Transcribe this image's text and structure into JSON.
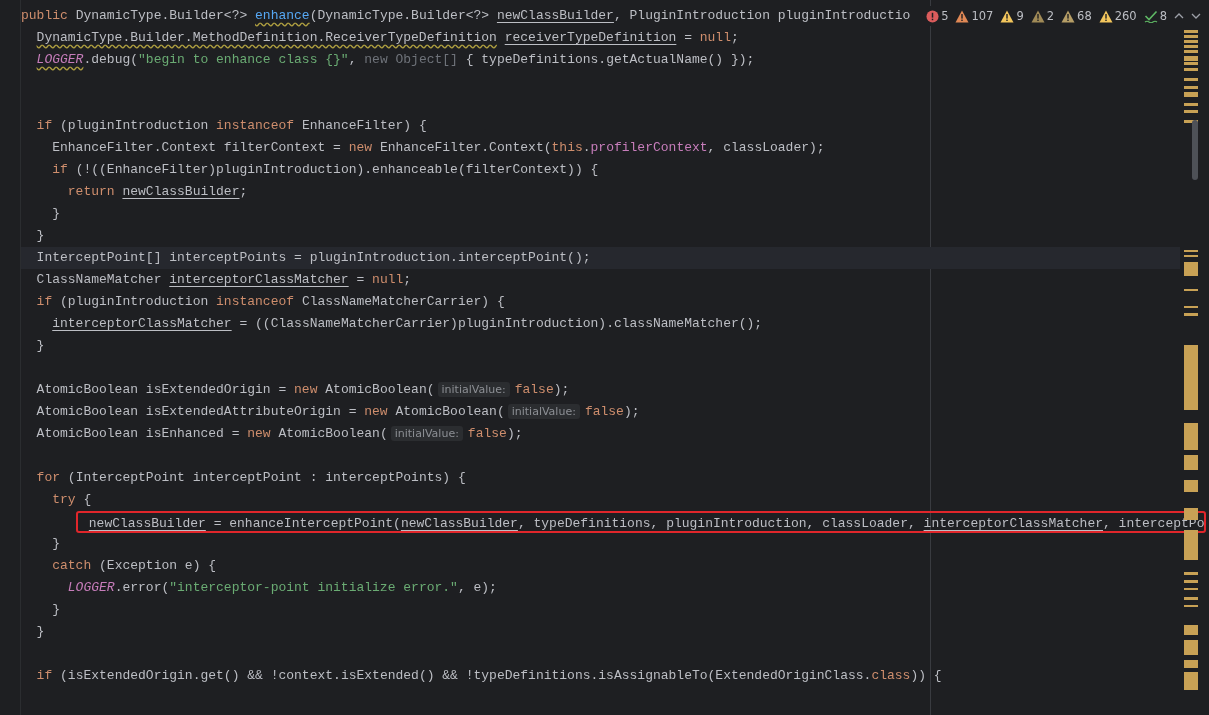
{
  "inspection": {
    "items": [
      {
        "kind": "error",
        "count": "5",
        "color": "#db5c5c"
      },
      {
        "kind": "warning",
        "count": "107",
        "color": "#e08855"
      },
      {
        "kind": "warning",
        "count": "9",
        "color": "#f2c55c"
      },
      {
        "kind": "warning",
        "count": "2",
        "color": "#a08a57"
      },
      {
        "kind": "warning",
        "count": "68",
        "color": "#b59d66"
      },
      {
        "kind": "warning",
        "count": "260",
        "color": "#f2c55c"
      },
      {
        "kind": "check",
        "count": "8",
        "color": "#5fb865"
      }
    ]
  },
  "blocks": [
    {
      "lines": [
        {
          "current": false,
          "highlighted": false,
          "tokens": [
            {
              "kind": "keyword",
              "text": "public"
            },
            {
              "kind": "plain",
              "text": " DynamicType.Builder<?> "
            },
            {
              "kind": "warnedmethod",
              "text": "enhance"
            },
            {
              "kind": "plain",
              "text": "(DynamicType.Builder<?> "
            },
            {
              "kind": "reassigned",
              "text": "newClassBuilder"
            },
            {
              "kind": "plain",
              "text": ", PluginIntroduction pluginIntroductio"
            }
          ]
        },
        {
          "current": false,
          "highlighted": false,
          "tokens": [
            {
              "kind": "warned",
              "text": "  DynamicType.Builder.MethodDefinition.ReceiverTypeDefinition"
            },
            {
              "kind": "reassigned",
              "text": " receiverTypeDefinition"
            },
            {
              "kind": "plain",
              "text": " = "
            },
            {
              "kind": "keyword",
              "text": "null"
            },
            {
              "kind": "plain",
              "text": ";"
            }
          ]
        },
        {
          "current": false,
          "highlighted": false,
          "tokens": [
            {
              "kind": "warnedstatic",
              "text": "  LOGGER"
            },
            {
              "kind": "plain",
              "text": ".debug("
            },
            {
              "kind": "string",
              "text": "\"begin to enhance class {}\""
            },
            {
              "kind": "plain",
              "text": ", "
            },
            {
              "kind": "dim",
              "text": "new Object[]"
            },
            {
              "kind": "plain",
              "text": " { typeDefinitions.getActualName() });"
            }
          ]
        }
      ]
    },
    {
      "lines": [
        {
          "current": false,
          "highlighted": false,
          "tokens": [
            {
              "kind": "keyword",
              "text": "  if"
            },
            {
              "kind": "plain",
              "text": " (pluginIntroduction "
            },
            {
              "kind": "keyword",
              "text": "instanceof"
            },
            {
              "kind": "plain",
              "text": " EnhanceFilter) {"
            }
          ]
        },
        {
          "current": false,
          "highlighted": false,
          "tokens": [
            {
              "kind": "plain",
              "text": "    EnhanceFilter.Context filterContext = "
            },
            {
              "kind": "keyword",
              "text": "new"
            },
            {
              "kind": "plain",
              "text": " EnhanceFilter.Context("
            },
            {
              "kind": "keyword",
              "text": "this"
            },
            {
              "kind": "plain",
              "text": "."
            },
            {
              "kind": "field",
              "text": "profilerContext"
            },
            {
              "kind": "plain",
              "text": ", classLoader);"
            }
          ]
        },
        {
          "current": false,
          "highlighted": false,
          "tokens": [
            {
              "kind": "keyword",
              "text": "    if"
            },
            {
              "kind": "plain",
              "text": " (!((EnhanceFilter)pluginIntroduction).enhanceable(filterContext)) {"
            }
          ]
        },
        {
          "current": false,
          "highlighted": false,
          "tokens": [
            {
              "kind": "keyword",
              "text": "      return"
            },
            {
              "kind": "reassigned",
              "text": " newClassBuilder"
            },
            {
              "kind": "plain",
              "text": ";"
            }
          ]
        },
        {
          "current": false,
          "highlighted": false,
          "tokens": [
            {
              "kind": "plain",
              "text": "    }"
            }
          ]
        },
        {
          "current": false,
          "highlighted": false,
          "tokens": [
            {
              "kind": "plain",
              "text": "  }"
            }
          ]
        },
        {
          "current": true,
          "highlighted": false,
          "tokens": [
            {
              "kind": "plain",
              "text": "  InterceptPoint[] interceptPoints = pluginIntroduction.interceptPoint();"
            }
          ]
        },
        {
          "current": false,
          "highlighted": false,
          "tokens": [
            {
              "kind": "plain",
              "text": "  ClassNameMatcher "
            },
            {
              "kind": "reassigned",
              "text": "interceptorClassMatcher"
            },
            {
              "kind": "plain",
              "text": " = "
            },
            {
              "kind": "keyword",
              "text": "null"
            },
            {
              "kind": "plain",
              "text": ";"
            }
          ]
        },
        {
          "current": false,
          "highlighted": false,
          "tokens": [
            {
              "kind": "keyword",
              "text": "  if"
            },
            {
              "kind": "plain",
              "text": " (pluginIntroduction "
            },
            {
              "kind": "keyword",
              "text": "instanceof"
            },
            {
              "kind": "plain",
              "text": " ClassNameMatcherCarrier) {"
            }
          ]
        },
        {
          "current": false,
          "highlighted": false,
          "tokens": [
            {
              "kind": "reassigned",
              "text": "    interceptorClassMatcher"
            },
            {
              "kind": "plain",
              "text": " = ((ClassNameMatcherCarrier)pluginIntroduction).classNameMatcher();"
            }
          ]
        },
        {
          "current": false,
          "highlighted": false,
          "tokens": [
            {
              "kind": "plain",
              "text": "  }"
            }
          ]
        }
      ]
    },
    {
      "lines": [
        {
          "current": false,
          "highlighted": false,
          "tokens": [
            {
              "kind": "plain",
              "text": "  AtomicBoolean isExtendedOrigin = "
            },
            {
              "kind": "keyword",
              "text": "new"
            },
            {
              "kind": "plain",
              "text": " AtomicBoolean("
            },
            {
              "kind": "hint",
              "text": "initialValue:"
            },
            {
              "kind": "keyword",
              "text": "false"
            },
            {
              "kind": "plain",
              "text": ");"
            }
          ]
        },
        {
          "current": false,
          "highlighted": false,
          "tokens": [
            {
              "kind": "plain",
              "text": "  AtomicBoolean isExtendedAttributeOrigin = "
            },
            {
              "kind": "keyword",
              "text": "new"
            },
            {
              "kind": "plain",
              "text": " AtomicBoolean("
            },
            {
              "kind": "hint",
              "text": "initialValue:"
            },
            {
              "kind": "keyword",
              "text": "false"
            },
            {
              "kind": "plain",
              "text": ");"
            }
          ]
        },
        {
          "current": false,
          "highlighted": false,
          "tokens": [
            {
              "kind": "plain",
              "text": "  AtomicBoolean isEnhanced = "
            },
            {
              "kind": "keyword",
              "text": "new"
            },
            {
              "kind": "plain",
              "text": " AtomicBoolean("
            },
            {
              "kind": "hint",
              "text": "initialValue:"
            },
            {
              "kind": "keyword",
              "text": "false"
            },
            {
              "kind": "plain",
              "text": ");"
            }
          ]
        }
      ]
    },
    {
      "lines": [
        {
          "current": false,
          "highlighted": false,
          "tokens": [
            {
              "kind": "keyword",
              "text": "  for"
            },
            {
              "kind": "plain",
              "text": " (InterceptPoint interceptPoint : interceptPoints) {"
            }
          ]
        },
        {
          "current": false,
          "highlighted": false,
          "tokens": [
            {
              "kind": "keyword",
              "text": "    try"
            },
            {
              "kind": "plain",
              "text": " {"
            }
          ]
        },
        {
          "current": false,
          "highlighted": true,
          "tokens": [
            {
              "kind": "reassigned",
              "text": "      newClassBuilder"
            },
            {
              "kind": "plain",
              "text": " = enhanceInterceptPoint("
            },
            {
              "kind": "reassigned",
              "text": "newClassBuilder"
            },
            {
              "kind": "plain",
              "text": ", typeDefinitions, pluginIntroduction, classLoader, "
            },
            {
              "kind": "reassigned",
              "text": "interceptorClassMatcher"
            },
            {
              "kind": "plain",
              "text": ", interceptPo"
            }
          ]
        },
        {
          "current": false,
          "highlighted": false,
          "tokens": [
            {
              "kind": "plain",
              "text": "    }"
            }
          ]
        },
        {
          "current": false,
          "highlighted": false,
          "tokens": [
            {
              "kind": "keyword",
              "text": "    catch"
            },
            {
              "kind": "plain",
              "text": " (Exception e) {"
            }
          ]
        },
        {
          "current": false,
          "highlighted": false,
          "tokens": [
            {
              "kind": "static",
              "text": "      LOGGER"
            },
            {
              "kind": "plain",
              "text": ".error("
            },
            {
              "kind": "string",
              "text": "\"interceptor-point initialize error.\""
            },
            {
              "kind": "plain",
              "text": ", e);"
            }
          ]
        },
        {
          "current": false,
          "highlighted": false,
          "tokens": [
            {
              "kind": "plain",
              "text": "    }"
            }
          ]
        },
        {
          "current": false,
          "highlighted": false,
          "tokens": [
            {
              "kind": "plain",
              "text": "  }"
            }
          ]
        }
      ]
    },
    {
      "lines": [
        {
          "current": false,
          "highlighted": false,
          "tokens": [
            {
              "kind": "keyword",
              "text": "  if"
            },
            {
              "kind": "plain",
              "text": " (isExtendedOrigin.get() && !context.isExtended() && !typeDefinitions.isAssignableTo(ExtendedOriginClass."
            },
            {
              "kind": "keyword",
              "text": "class"
            },
            {
              "kind": "plain",
              "text": ")) {"
            }
          ]
        }
      ]
    }
  ]
}
